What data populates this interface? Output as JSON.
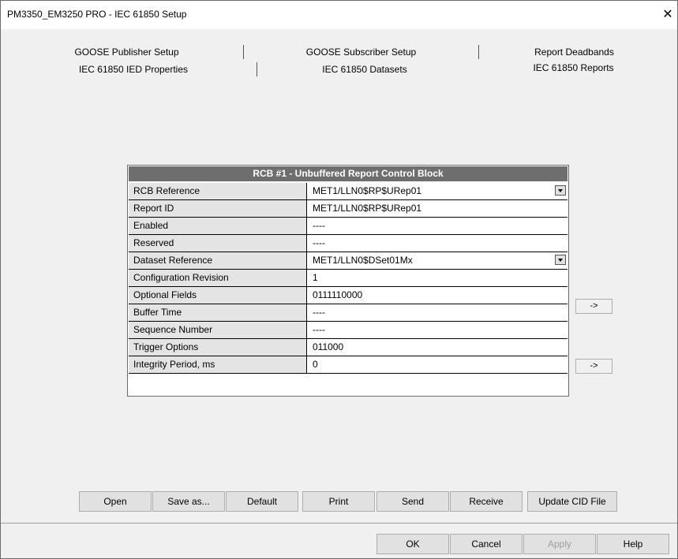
{
  "window": {
    "title": "PM3350_EM3250 PRO - IEC 61850 Setup",
    "close_label": "✕"
  },
  "tabs": {
    "row1": [
      "GOOSE Publisher Setup",
      "GOOSE Subscriber Setup",
      "Report Deadbands"
    ],
    "row2": [
      "IEC 61850 IED Properties",
      "IEC 61850 Datasets",
      "IEC 61850 Reports"
    ],
    "active": "IEC 61850 Reports"
  },
  "panel": {
    "header": "RCB #1 - Unbuffered Report Control Block",
    "rows": [
      {
        "label": "RCB Reference",
        "value": "MET1/LLN0$RP$URep01"
      },
      {
        "label": "Report ID",
        "value": "MET1/LLN0$RP$URep01"
      },
      {
        "label": "Enabled",
        "value": "----"
      },
      {
        "label": "Reserved",
        "value": "----"
      },
      {
        "label": "Dataset Reference",
        "value": "MET1/LLN0$DSet01Mx"
      },
      {
        "label": "Configuration Revision",
        "value": "1"
      },
      {
        "label": "Optional Fields",
        "value": "0111110000"
      },
      {
        "label": "Buffer Time",
        "value": "----"
      },
      {
        "label": "Sequence Number",
        "value": "----"
      },
      {
        "label": "Trigger Options",
        "value": "011000"
      },
      {
        "label": "Integrity Period, ms",
        "value": "0"
      }
    ],
    "arrow_label": "->"
  },
  "buttons": {
    "open": "Open",
    "save_as": "Save as...",
    "default": "Default",
    "print": "Print",
    "send": "Send",
    "receive": "Receive",
    "update_cid": "Update CID File",
    "ok": "OK",
    "cancel": "Cancel",
    "apply": "Apply",
    "help": "Help"
  }
}
